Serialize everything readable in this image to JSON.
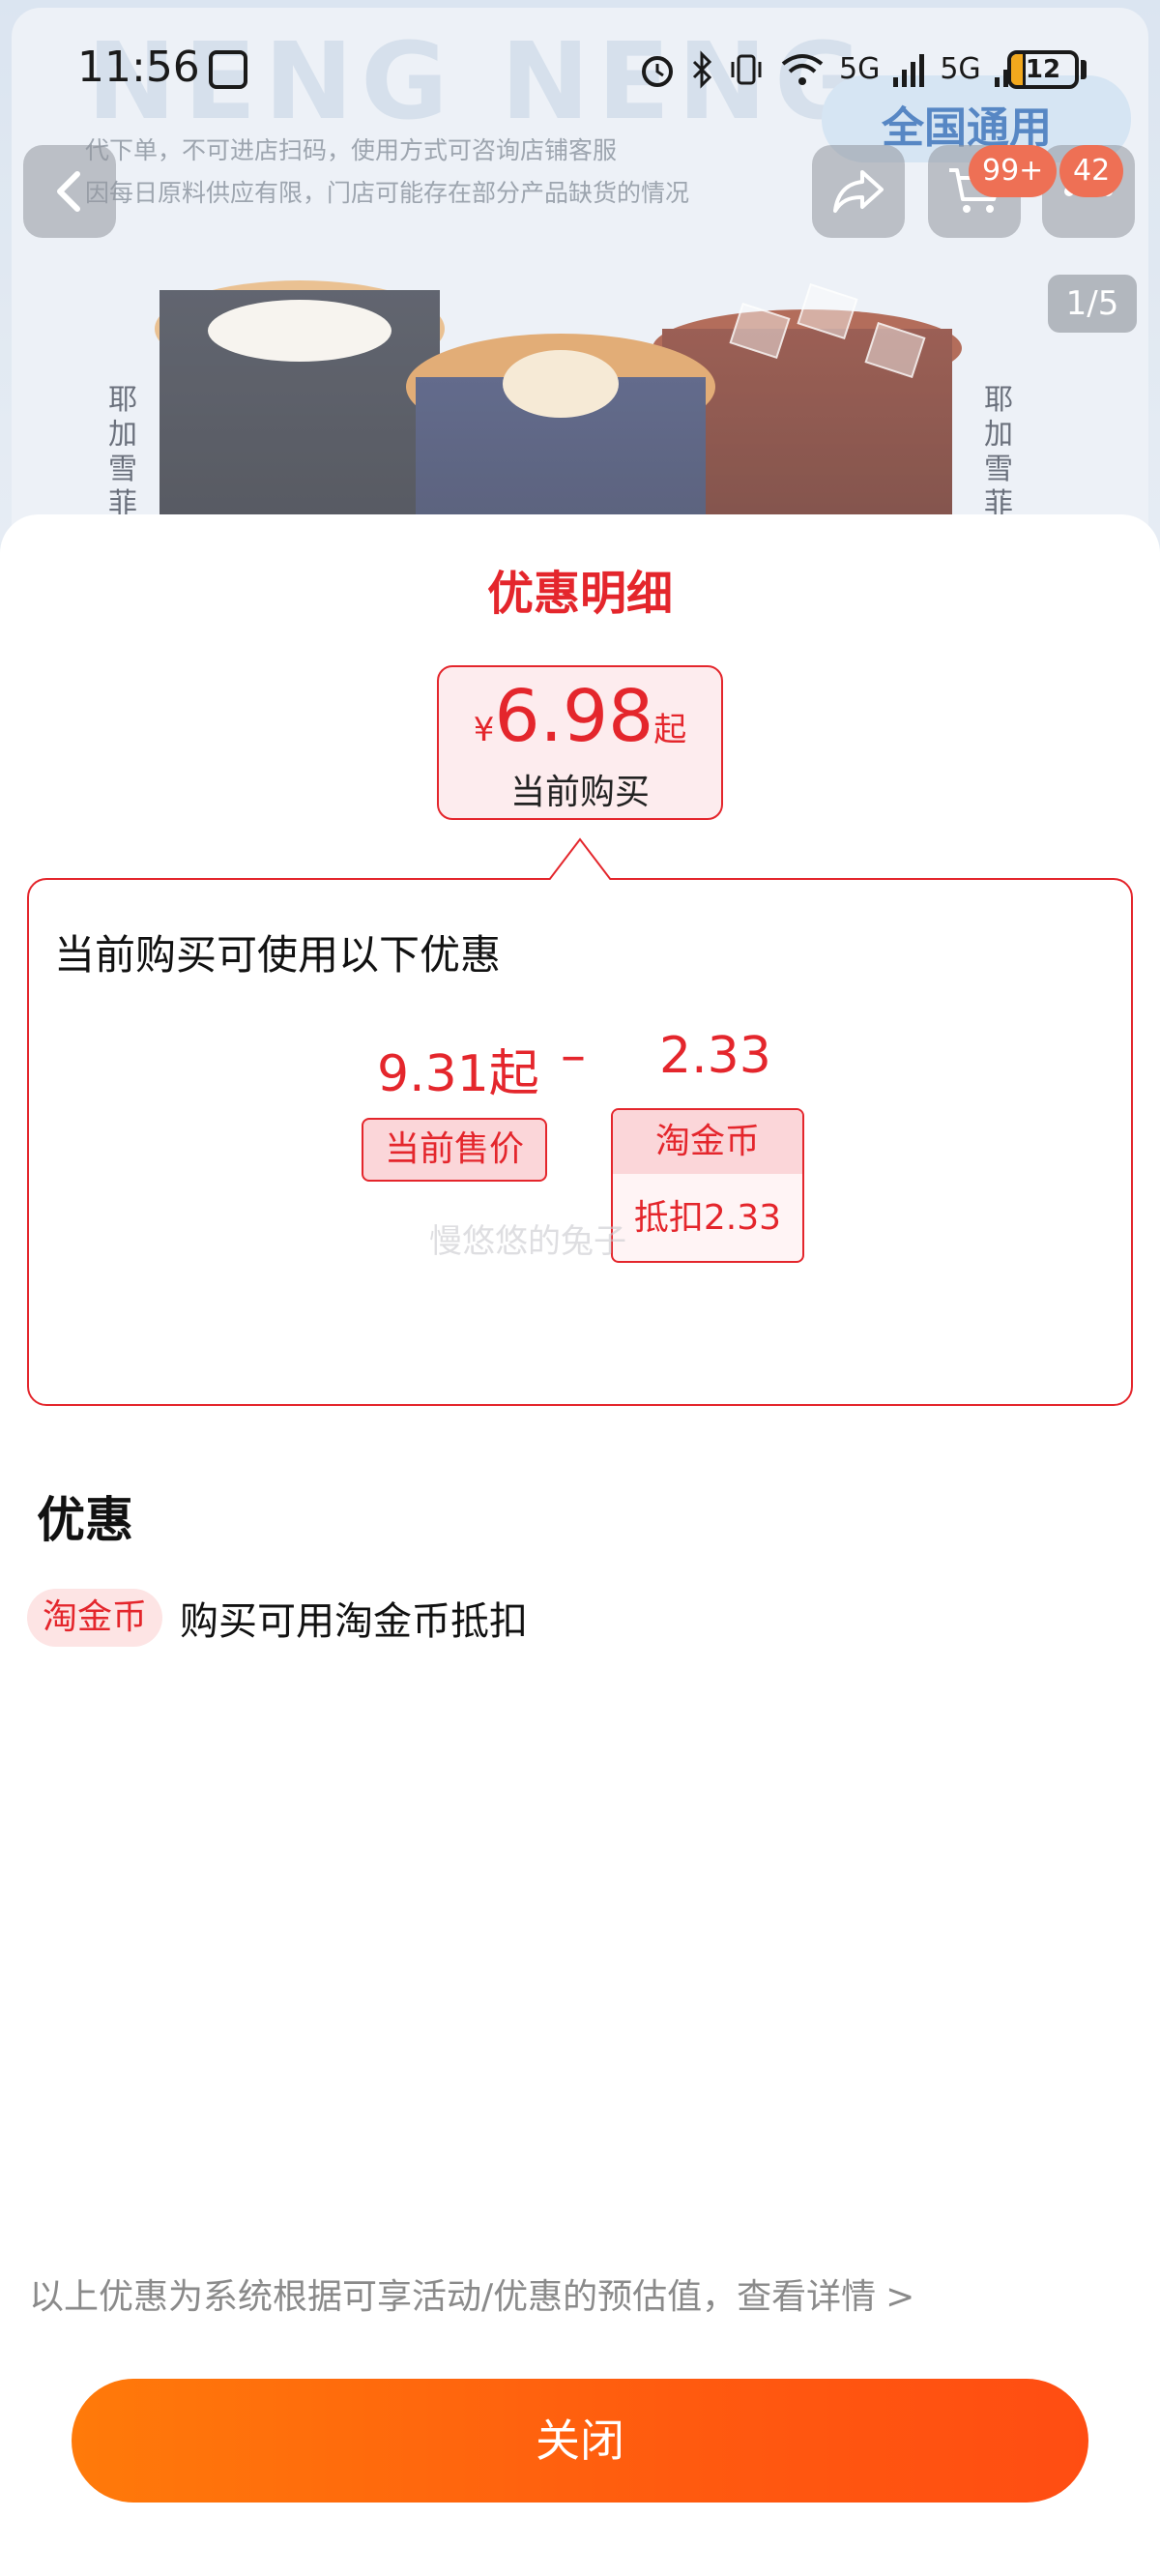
{
  "status_bar": {
    "time": "11:56",
    "battery_level": 12,
    "battery_label": "12",
    "network_1": "5G",
    "network_2": "5G"
  },
  "background": {
    "badge_text": "全国通用",
    "notice_line1": "代下单，不可进店扫码，使用方式可咨询店铺客服",
    "notice_line2": "因每日原料供应有限，门店可能存在部分产品缺货的情况",
    "left_vertical_text": "耶加雪菲",
    "right_vertical_text": "耶加雪菲",
    "cart_badge": "99+",
    "message_badge": "42",
    "page_indicator": "1/5",
    "icons": [
      "back-icon",
      "share-icon",
      "cart-icon",
      "more-icon"
    ]
  },
  "sheet": {
    "title": "优惠明细",
    "price": {
      "currency": "¥",
      "amount": "6.98",
      "suffix": "起",
      "label": "当前购买"
    },
    "detail": {
      "title": "当前购买可使用以下优惠",
      "current_price": "9.31起",
      "minus": "–",
      "discount": "2.33",
      "current_price_label": "当前售价",
      "coin_label": "淘金币",
      "coin_value": "抵扣2.33",
      "watermark": "慢悠悠的兔子"
    },
    "section_title": "优惠",
    "offer": {
      "tag": "淘金币",
      "text": "购买可用淘金币抵扣"
    },
    "footnote": "以上优惠为系统根据可享活动/优惠的预估值，查看详情",
    "footnote_arrow": ">",
    "close_label": "关闭"
  },
  "colors": {
    "accent_red": "#e4262c",
    "button_orange": "#ff6a0c",
    "brand_blue": "#1f5fb0"
  }
}
